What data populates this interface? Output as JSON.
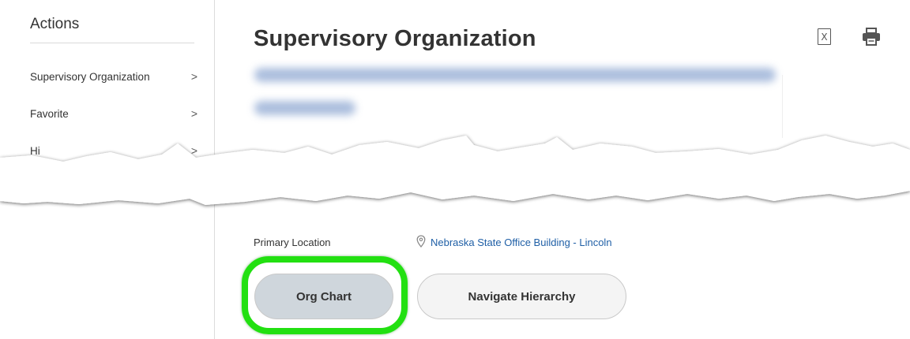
{
  "sidebar": {
    "title": "Actions",
    "items": [
      {
        "label": "Supervisory Organization",
        "chevron": ">"
      },
      {
        "label": "Favorite",
        "chevron": ">"
      },
      {
        "label": "Hi",
        "chevron": ">"
      }
    ]
  },
  "header": {
    "title": "Supervisory Organization",
    "icons": [
      "excel-export-icon",
      "print-icon"
    ],
    "excel_glyph": "X"
  },
  "details": {
    "primary_location_label": "Primary Location",
    "primary_location_value": "Nebraska State Office Building - Lincoln"
  },
  "buttons": {
    "org_chart": "Org Chart",
    "navigate_hierarchy": "Navigate Hierarchy"
  },
  "colors": {
    "highlight": "#22e011",
    "link": "#1f5fa6",
    "org_chart_bg": "#cfd6dc",
    "navigate_bg": "#f4f4f4"
  }
}
